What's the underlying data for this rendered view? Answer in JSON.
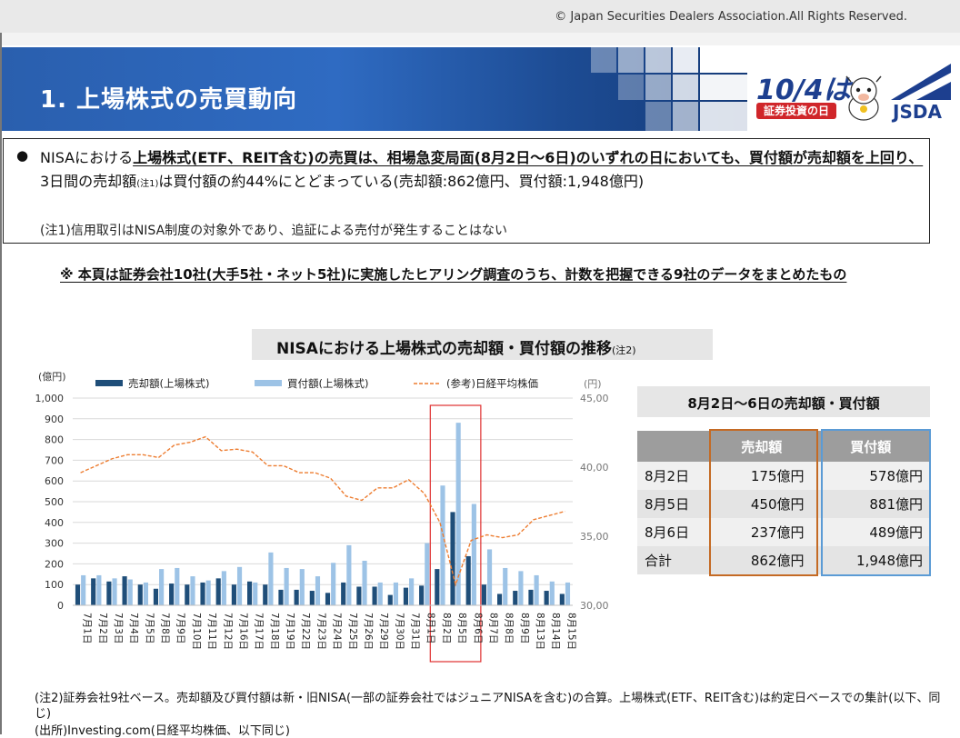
{
  "header": {
    "copyright": "© Japan Securities Dealers Association.All Rights Reserved.",
    "title": "1. 上場株式の売買動向",
    "event_logo_line1": "10/4は",
    "event_logo_line2": "証券投資の日",
    "org_logo": "JSDA",
    "mascot_icon": "mascot-icon",
    "jsda_mark_icon": "jsda-mark-icon"
  },
  "summary": {
    "bullet": "●",
    "part1": "NISAにおける",
    "part2_underlined": "上場株式(ETF、REIT含む)の売買は、相場急変局面(8月2日～6日)のいずれの日においても、買付額が売却額を上回り、",
    "part3": "3日間の売却額",
    "part3_note": "(注1)",
    "part4": "は買付額の約44%にとどまっている(売却額:862億円、買付額:1,948億円)",
    "note1": "(注1)信用取引はNISA制度の対象外であり、追証による売付が発生することはない"
  },
  "notice": "※ 本頁は証券会社10社(大手5社・ネット5社)に実施したヒアリング調査のうち、計数を把握できる9社のデータをまとめたもの",
  "chart_title": "NISAにおける上場株式の売却額・買付額の推移",
  "chart_title_note": "(注2)",
  "chart_data": {
    "type": "bar",
    "categories": [
      "7月1日",
      "7月2日",
      "7月3日",
      "7月4日",
      "7月5日",
      "7月8日",
      "7月9日",
      "7月10日",
      "7月11日",
      "7月12日",
      "7月16日",
      "7月17日",
      "7月18日",
      "7月19日",
      "7月22日",
      "7月23日",
      "7月24日",
      "7月25日",
      "7月26日",
      "7月29日",
      "7月30日",
      "7月31日",
      "8月1日",
      "8月2日",
      "8月5日",
      "8月6日",
      "8月7日",
      "8月8日",
      "8月9日",
      "8月13日",
      "8月14日",
      "8月15日"
    ],
    "series": [
      {
        "name": "売却額(上場株式)",
        "color": "#1f4e79",
        "values": [
          100,
          130,
          115,
          140,
          100,
          80,
          105,
          100,
          110,
          130,
          100,
          115,
          100,
          75,
          75,
          70,
          60,
          110,
          90,
          90,
          50,
          85,
          95,
          175,
          450,
          237,
          100,
          55,
          70,
          75,
          70,
          55
        ]
      },
      {
        "name": "買付額(上場株式)",
        "color": "#9dc3e6",
        "values": [
          145,
          145,
          130,
          125,
          110,
          175,
          180,
          140,
          120,
          165,
          185,
          110,
          255,
          180,
          175,
          140,
          205,
          290,
          215,
          110,
          110,
          130,
          300,
          578,
          881,
          489,
          270,
          180,
          165,
          145,
          115,
          110
        ]
      }
    ],
    "line_series": {
      "name": "(参考)日経平均株価",
      "color": "#ed7d31",
      "values": [
        39600,
        40100,
        40600,
        40900,
        40900,
        40700,
        41600,
        41800,
        42200,
        41200,
        41300,
        41100,
        40100,
        40100,
        39600,
        39600,
        39200,
        37900,
        37600,
        38500,
        38500,
        39100,
        38100,
        36000,
        31500,
        34700,
        35100,
        34900,
        35100,
        36200,
        36500,
        36800
      ]
    },
    "ylabel_left": "(億円)",
    "ylabel_right": "(円)",
    "ylim": [
      0,
      1000
    ],
    "yticks_left": [
      "0",
      "100",
      "200",
      "300",
      "400",
      "500",
      "600",
      "700",
      "800",
      "900",
      "1,000"
    ],
    "ylim_right": [
      30000,
      45000
    ],
    "yticks_right": [
      "30,000",
      "35,000",
      "40,000",
      "45,000"
    ],
    "highlight": [
      "8月2日",
      "8月6日"
    ],
    "grid": "horizontal",
    "legend": "top"
  },
  "table": {
    "title": "8月2日～6日の売却額・買付額",
    "headers": [
      "",
      "売却額",
      "買付額"
    ],
    "rows": [
      [
        "8月2日",
        "175億円",
        "578億円"
      ],
      [
        "8月5日",
        "450億円",
        "881億円"
      ],
      [
        "8月6日",
        "237億円",
        "489億円"
      ],
      [
        "合計",
        "862億円",
        "1,948億円"
      ]
    ]
  },
  "footnotes": {
    "note2": "(注2)証券会社9社ベース。売却額及び買付額は新・旧NISA(一部の証券会社ではジュニアNISAを含む)の合算。上場株式(ETF、REIT含む)は約定日ベースでの集計(以下、同じ)",
    "source": "(出所)Investing.com(日経平均株価、以下同じ)"
  }
}
